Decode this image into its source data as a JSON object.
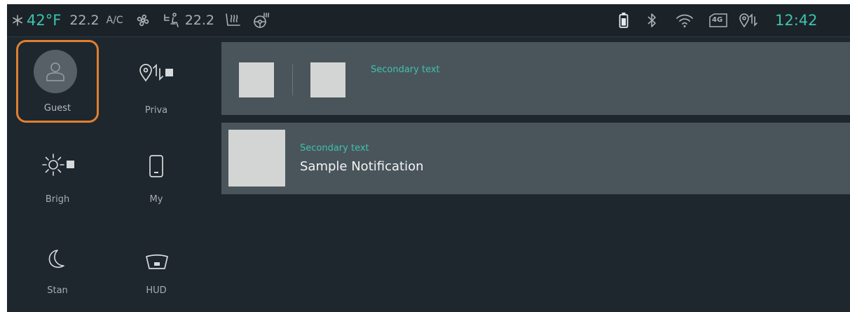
{
  "status_bar": {
    "ac_icon": "snowflake-icon",
    "outside_temp": "42°F",
    "driver_temp": "22.2",
    "ac_label": "A/C",
    "fan_icon": "fan-icon",
    "airflow_icon": "seat-airflow-icon",
    "passenger_temp": "22.2",
    "seat_heat_icon": "seat-heat-icon",
    "steering_heat_icon": "steering-heat-icon",
    "battery_icon": "battery-icon",
    "bluetooth_icon": "bluetooth-icon",
    "wifi_icon": "wifi-icon",
    "network_badge": "4G",
    "location_icon": "location-sharing-icon",
    "time": "12:42"
  },
  "quick_settings": [
    {
      "id": "profile",
      "label": "Guest",
      "icon": "person-icon",
      "selected": true
    },
    {
      "id": "privacy",
      "label": "Priva",
      "icon": "location-sharing-icon"
    },
    {
      "id": "brightness",
      "label": "Brigh",
      "icon": "brightness-icon"
    },
    {
      "id": "my-device",
      "label": "My",
      "icon": "phone-icon"
    },
    {
      "id": "standby",
      "label": "Stan",
      "icon": "moon-icon"
    },
    {
      "id": "hud",
      "label": "HUD",
      "icon": "hud-icon"
    }
  ],
  "notifications": [
    {
      "secondary": "Secondary text",
      "primary": ""
    },
    {
      "secondary": "Secondary text",
      "primary": "Sample Notification"
    }
  ],
  "colors": {
    "accent": "#3fc1ad",
    "selection": "#e07f32",
    "card": "#4a555b",
    "background": "#1e272d"
  }
}
